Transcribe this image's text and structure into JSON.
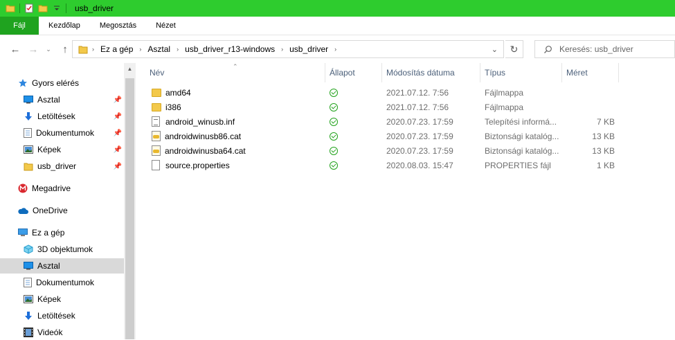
{
  "window": {
    "title": "usb_driver",
    "accent_color": "#2ecc2e"
  },
  "ribbon": {
    "tabs": [
      {
        "label": "Fájl"
      },
      {
        "label": "Kezdőlap"
      },
      {
        "label": "Megosztás"
      },
      {
        "label": "Nézet"
      }
    ]
  },
  "address": {
    "crumbs": [
      "Ez a gép",
      "Asztal",
      "usb_driver_r13-windows",
      "usb_driver"
    ],
    "search_placeholder": "Keresés: usb_driver"
  },
  "sidebar": {
    "items": [
      {
        "label": "Gyors elérés",
        "icon": "star-icon",
        "pinned": false
      },
      {
        "label": "Asztal",
        "icon": "desktop-icon",
        "pinned": true
      },
      {
        "label": "Letöltések",
        "icon": "download-arrow-icon",
        "pinned": true
      },
      {
        "label": "Dokumentumok",
        "icon": "document-icon",
        "pinned": true
      },
      {
        "label": "Képek",
        "icon": "pictures-icon",
        "pinned": true
      },
      {
        "label": "usb_driver",
        "icon": "folder-icon",
        "pinned": true
      },
      {
        "label": "Megadrive",
        "icon": "mega-icon",
        "pinned": false
      },
      {
        "label": "OneDrive",
        "icon": "cloud-icon",
        "pinned": false
      },
      {
        "label": "Ez a gép",
        "icon": "computer-icon",
        "pinned": false
      },
      {
        "label": "3D objektumok",
        "icon": "cube-icon",
        "pinned": false
      },
      {
        "label": "Asztal",
        "icon": "desktop-icon",
        "pinned": false,
        "selected": true
      },
      {
        "label": "Dokumentumok",
        "icon": "document-icon",
        "pinned": false
      },
      {
        "label": "Képek",
        "icon": "pictures-icon",
        "pinned": false
      },
      {
        "label": "Letöltések",
        "icon": "download-arrow-icon",
        "pinned": false
      },
      {
        "label": "Videók",
        "icon": "film-icon",
        "pinned": false
      }
    ]
  },
  "columns": [
    "Név",
    "Állapot",
    "Módosítás dátuma",
    "Típus",
    "Méret"
  ],
  "files": [
    {
      "name": "amd64",
      "kind": "folder",
      "date": "2021.07.12. 7:56",
      "type": "Fájlmappa",
      "size": ""
    },
    {
      "name": "i386",
      "kind": "folder",
      "date": "2021.07.12. 7:56",
      "type": "Fájlmappa",
      "size": ""
    },
    {
      "name": "android_winusb.inf",
      "kind": "inf",
      "date": "2020.07.23. 17:59",
      "type": "Telepítési informá...",
      "size": "7 KB"
    },
    {
      "name": "androidwinusb86.cat",
      "kind": "cat",
      "date": "2020.07.23. 17:59",
      "type": "Biztonsági katalóg...",
      "size": "13 KB"
    },
    {
      "name": "androidwinusba64.cat",
      "kind": "cat",
      "date": "2020.07.23. 17:59",
      "type": "Biztonsági katalóg...",
      "size": "13 KB"
    },
    {
      "name": "source.properties",
      "kind": "file",
      "date": "2020.08.03. 15:47",
      "type": "PROPERTIES fájl",
      "size": "1 KB"
    }
  ]
}
